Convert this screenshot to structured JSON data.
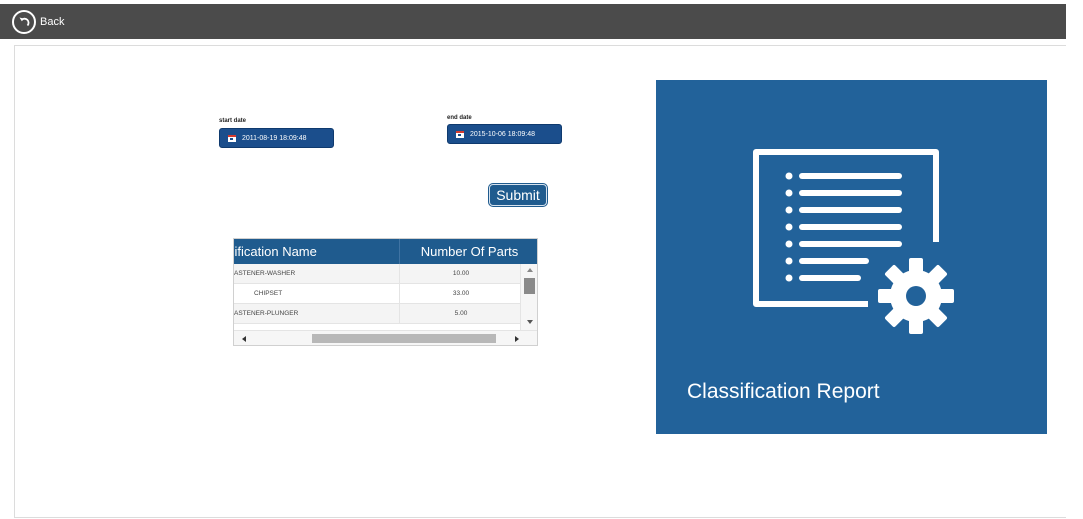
{
  "nav": {
    "back_label": "Back"
  },
  "filters": {
    "start_date_label": "start date",
    "start_date_value": "2011-08-19 18:09:48",
    "end_date_label": "end date",
    "end_date_value": "2015-10-06 18:09:48",
    "submit_label": "Submit"
  },
  "grid": {
    "columns": [
      "sification Name",
      "Number Of Parts"
    ],
    "rows": [
      {
        "name": "ASTENER-WASHER",
        "parts": "10.00"
      },
      {
        "name": "CHIPSET",
        "parts": "33.00"
      },
      {
        "name": "ASTENER-PLUNGER",
        "parts": "5.00"
      }
    ]
  },
  "tile": {
    "label": "Classification Report",
    "icon": "report-settings-icon",
    "color": "#22629a"
  },
  "colors": {
    "topbar": "#4b4b4b",
    "accent": "#1f5b8e"
  }
}
